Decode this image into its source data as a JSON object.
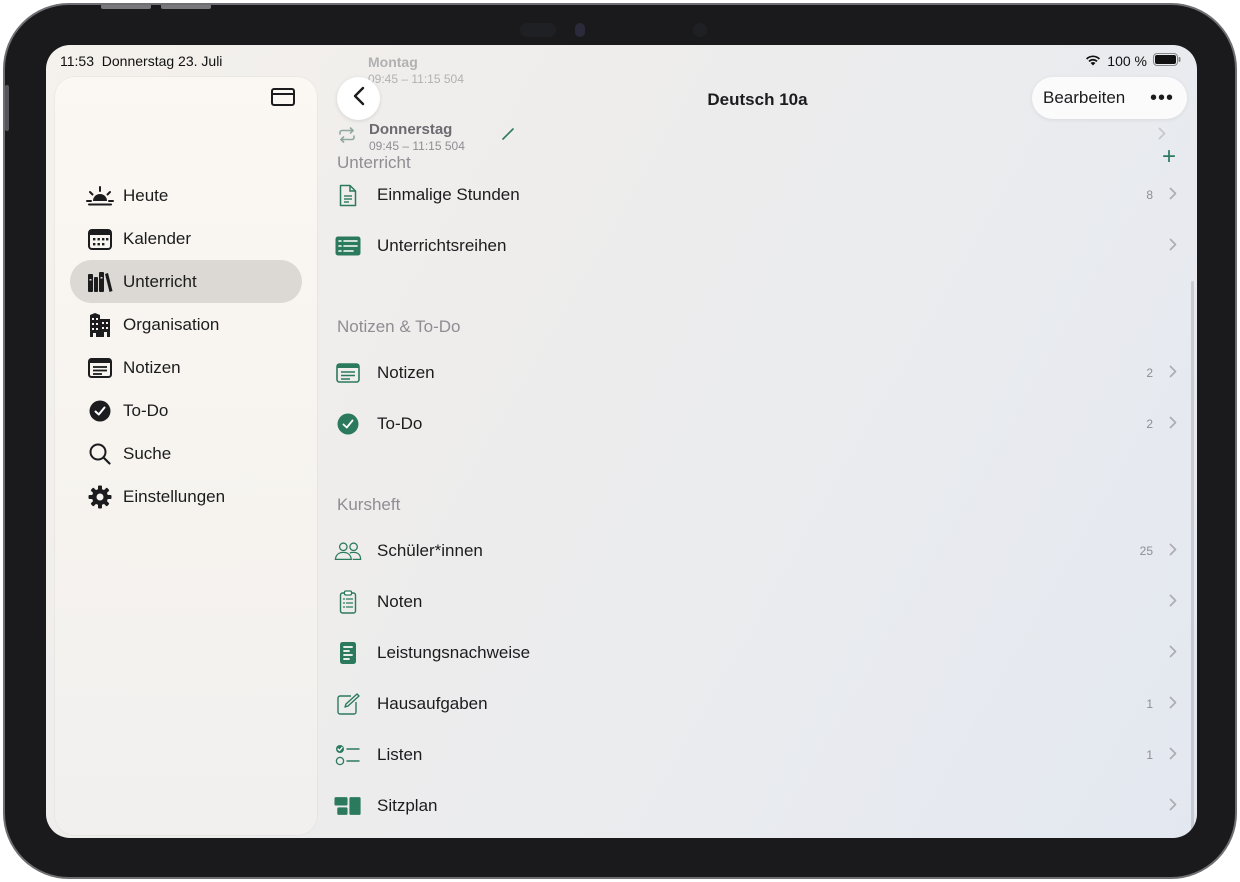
{
  "status_bar": {
    "time": "11:53",
    "date": "Donnerstag 23. Juli",
    "battery": "100 %"
  },
  "sidebar": {
    "items": [
      {
        "label": "Heute",
        "icon": "sunrise-icon"
      },
      {
        "label": "Kalender",
        "icon": "calendar-icon"
      },
      {
        "label": "Unterricht",
        "icon": "books-icon",
        "selected": true
      },
      {
        "label": "Organisation",
        "icon": "building-icon"
      },
      {
        "label": "Notizen",
        "icon": "note-icon"
      },
      {
        "label": "To-Do",
        "icon": "checkmark-circle-icon"
      },
      {
        "label": "Suche",
        "icon": "search-icon"
      },
      {
        "label": "Einstellungen",
        "icon": "gear-icon"
      }
    ]
  },
  "header": {
    "title": "Deutsch 10a",
    "edit_label": "Bearbeiten",
    "more_label": "•••"
  },
  "schedule_partial": [
    {
      "day": "Montag",
      "time": "09:45 – 11:15 504"
    },
    {
      "day": "Donnerstag",
      "time": "09:45 – 11:15 504"
    }
  ],
  "sections": {
    "unterricht": {
      "title": "Unterricht",
      "add_label": "+",
      "rows": [
        {
          "label": "Einmalige Stunden",
          "count": "8",
          "icon": "document-icon"
        },
        {
          "label": "Unterrichtsreihen",
          "count": "",
          "icon": "list-rows-icon"
        }
      ]
    },
    "notizen": {
      "title": "Notizen & To-Do",
      "rows": [
        {
          "label": "Notizen",
          "count": "2",
          "icon": "note-icon"
        },
        {
          "label": "To-Do",
          "count": "2",
          "icon": "checkmark-circle-icon"
        }
      ]
    },
    "kursheft": {
      "title": "Kursheft",
      "rows": [
        {
          "label": "Schüler*innen",
          "count": "25",
          "icon": "people-icon"
        },
        {
          "label": "Noten",
          "count": "",
          "icon": "clipboard-icon"
        },
        {
          "label": "Leistungsnachweise",
          "count": "",
          "icon": "report-icon"
        },
        {
          "label": "Hausaufgaben",
          "count": "1",
          "icon": "pencil-square-icon"
        },
        {
          "label": "Listen",
          "count": "1",
          "icon": "checklist-icon"
        },
        {
          "label": "Sitzplan",
          "count": "",
          "icon": "seating-icon"
        }
      ]
    }
  },
  "colors": {
    "accent": "#2c7a5e",
    "selected_bg": "#dcd8d4",
    "secondary_text": "#8e8e93"
  }
}
